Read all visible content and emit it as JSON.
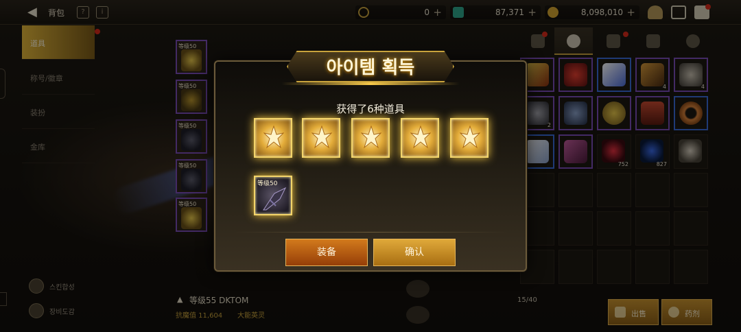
{
  "topbar": {
    "title": "背包",
    "currency1_value": "0",
    "currency2_value": "87,371",
    "currency3_value": "8,098,010",
    "plus": "+"
  },
  "left_menu": {
    "items": [
      {
        "label": "道具"
      },
      {
        "label": "称号/徽章"
      },
      {
        "label": "装扮"
      },
      {
        "label": "金库"
      }
    ],
    "bottom_buttons": [
      {
        "label": "스킨합성"
      },
      {
        "label": "장비도감"
      }
    ]
  },
  "equip_slots": [
    {
      "level": "等级50"
    },
    {
      "level": "等级50"
    },
    {
      "level": "等级50"
    },
    {
      "level": "等级50"
    },
    {
      "level": "等级50"
    }
  ],
  "character": {
    "name": "等级55 DKTOM",
    "stat": "抗魔值 11,604",
    "title": "大能英灵"
  },
  "inventory": {
    "count": "15/40",
    "quantities": [
      "4",
      "4",
      "2",
      "752",
      "827"
    ],
    "sell_label": "出售",
    "potion_label": "药剂"
  },
  "dialog": {
    "title": "아이템 획득",
    "message": "获得了6种道具",
    "reward_weapon_level": "等级50",
    "equip_label": "装备",
    "confirm_label": "确认"
  },
  "colors": {
    "accent_gold": "#c9a33c",
    "equip_button": "#d27a1c",
    "confirm_button": "#e0a93a",
    "purple_frame": "#7a4db8",
    "notification_red": "#d82a1a"
  }
}
